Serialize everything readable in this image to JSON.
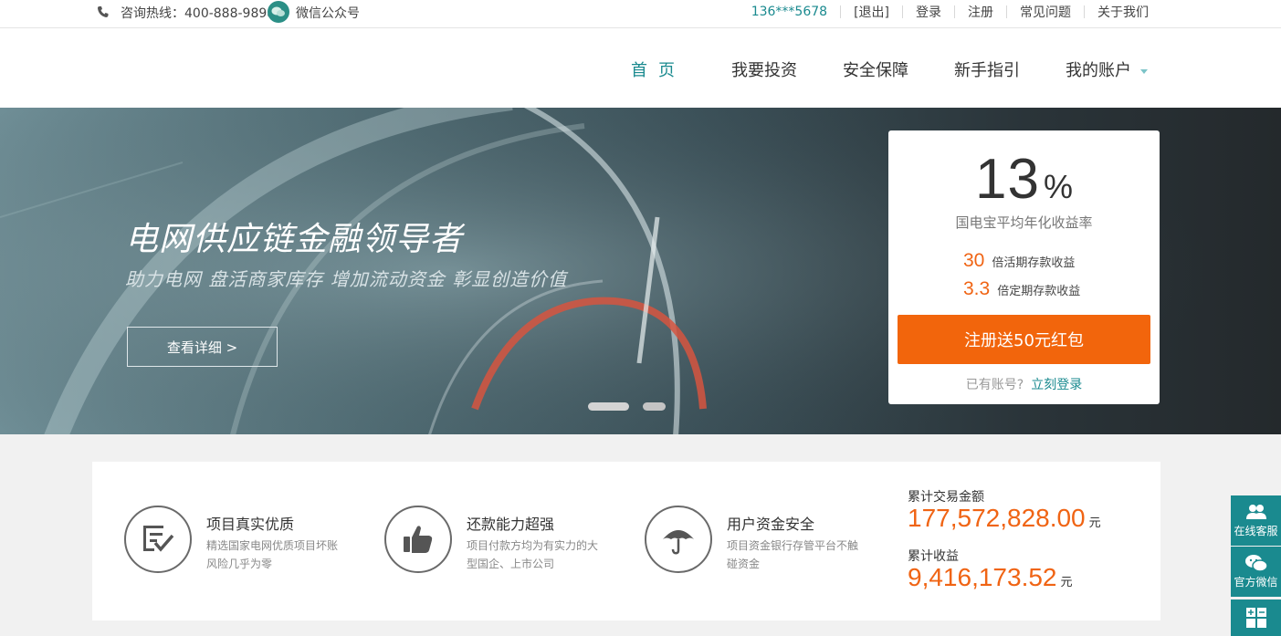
{
  "topbar": {
    "hotline": "咨询热线：400-888-9898",
    "wechat": "微信公众号",
    "user": "136***5678",
    "logout": "[退出]",
    "login": "登录",
    "register": "注册",
    "faq": "常见问题",
    "about": "关于我们"
  },
  "nav": {
    "home": "首页",
    "invest": "我要投资",
    "security": "安全保障",
    "guide": "新手指引",
    "account": "我的账户"
  },
  "banner": {
    "headline": "电网供应链金融领导者",
    "subline": "助力电网  盘活商家库存  增加流动资金  彰显创造价值",
    "detail_button": "查看详细  >"
  },
  "card": {
    "rate": "13",
    "rate_unit": "%",
    "rate_label": "国电宝平均年化收益率",
    "mult1_num": "30",
    "mult1_text": "倍活期存款收益",
    "mult2_num": "3.3",
    "mult2_text": "倍定期存款收益",
    "register_button": "注册送50元红包",
    "have_account": "已有账号?",
    "login_now": "立刻登录"
  },
  "features": [
    {
      "title": "项目真实优质",
      "desc": "精选国家电网优质项目坏账风险几乎为零"
    },
    {
      "title": "还款能力超强",
      "desc": "项目付款方均为有实力的大型国企、上市公司"
    },
    {
      "title": "用户资金安全",
      "desc": "项目资金银行存管平台不触碰资金"
    }
  ],
  "stats": {
    "total_label": "累计交易金额",
    "total_value": "177,572,828.00",
    "total_unit": "元",
    "income_label": "累计收益",
    "income_value": "9,416,173.52",
    "income_unit": "元"
  },
  "side": {
    "service": "在线客服",
    "wechat": "官方微信"
  },
  "colors": {
    "accent": "#1a8a8f",
    "orange": "#f2650c"
  }
}
